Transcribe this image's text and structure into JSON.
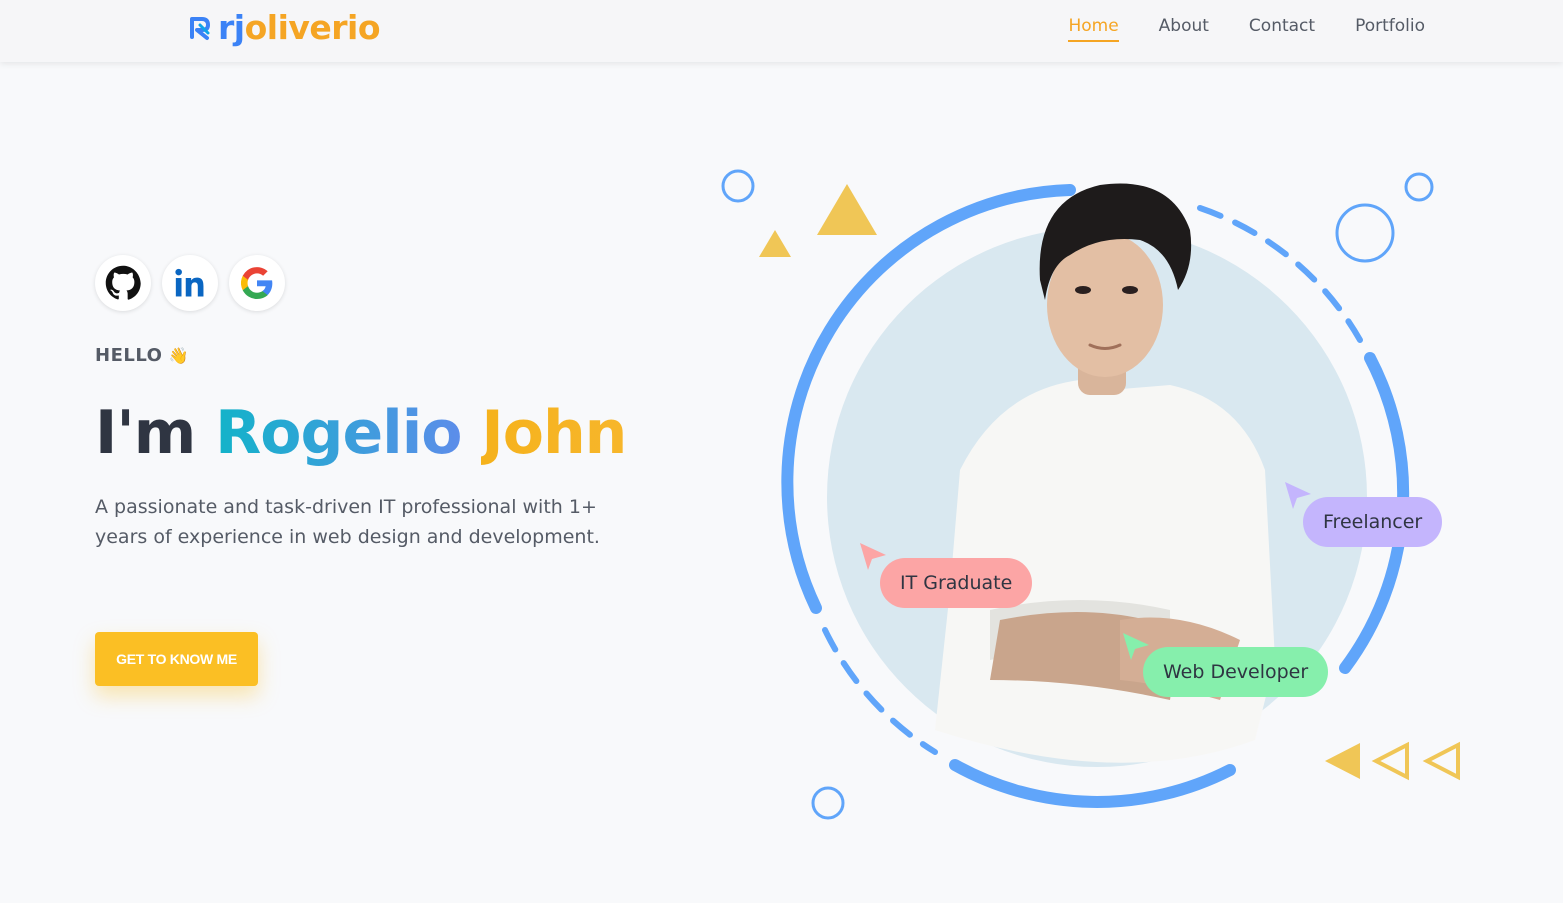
{
  "brand": {
    "logo_rj": "rj",
    "logo_rest": "oliverio"
  },
  "nav": {
    "items": [
      {
        "label": "Home",
        "active": true
      },
      {
        "label": "About",
        "active": false
      },
      {
        "label": "Contact",
        "active": false
      },
      {
        "label": "Portfolio",
        "active": false
      }
    ]
  },
  "socials": [
    {
      "name": "github-icon"
    },
    {
      "name": "linkedin-icon"
    },
    {
      "name": "google-icon"
    }
  ],
  "hero": {
    "greeting": "HELLO",
    "greeting_emoji": "👋",
    "headline_prefix": "I'm",
    "headline_first": "Rogelio",
    "headline_last": "John",
    "description": "A passionate and task-driven IT professional with 1+ years of experience in web design and development.",
    "cta_label": "GET TO KNOW ME"
  },
  "tags": {
    "it": "IT Graduate",
    "freelancer": "Freelancer",
    "web": "Web Developer"
  },
  "colors": {
    "accent": "#f5a524",
    "blue": "#3b82f6",
    "ring": "#60a5fa",
    "tag_it": "#fca5a5",
    "tag_freelancer": "#c4b5fd",
    "tag_web": "#86efac",
    "triangle": "#f0c656"
  }
}
